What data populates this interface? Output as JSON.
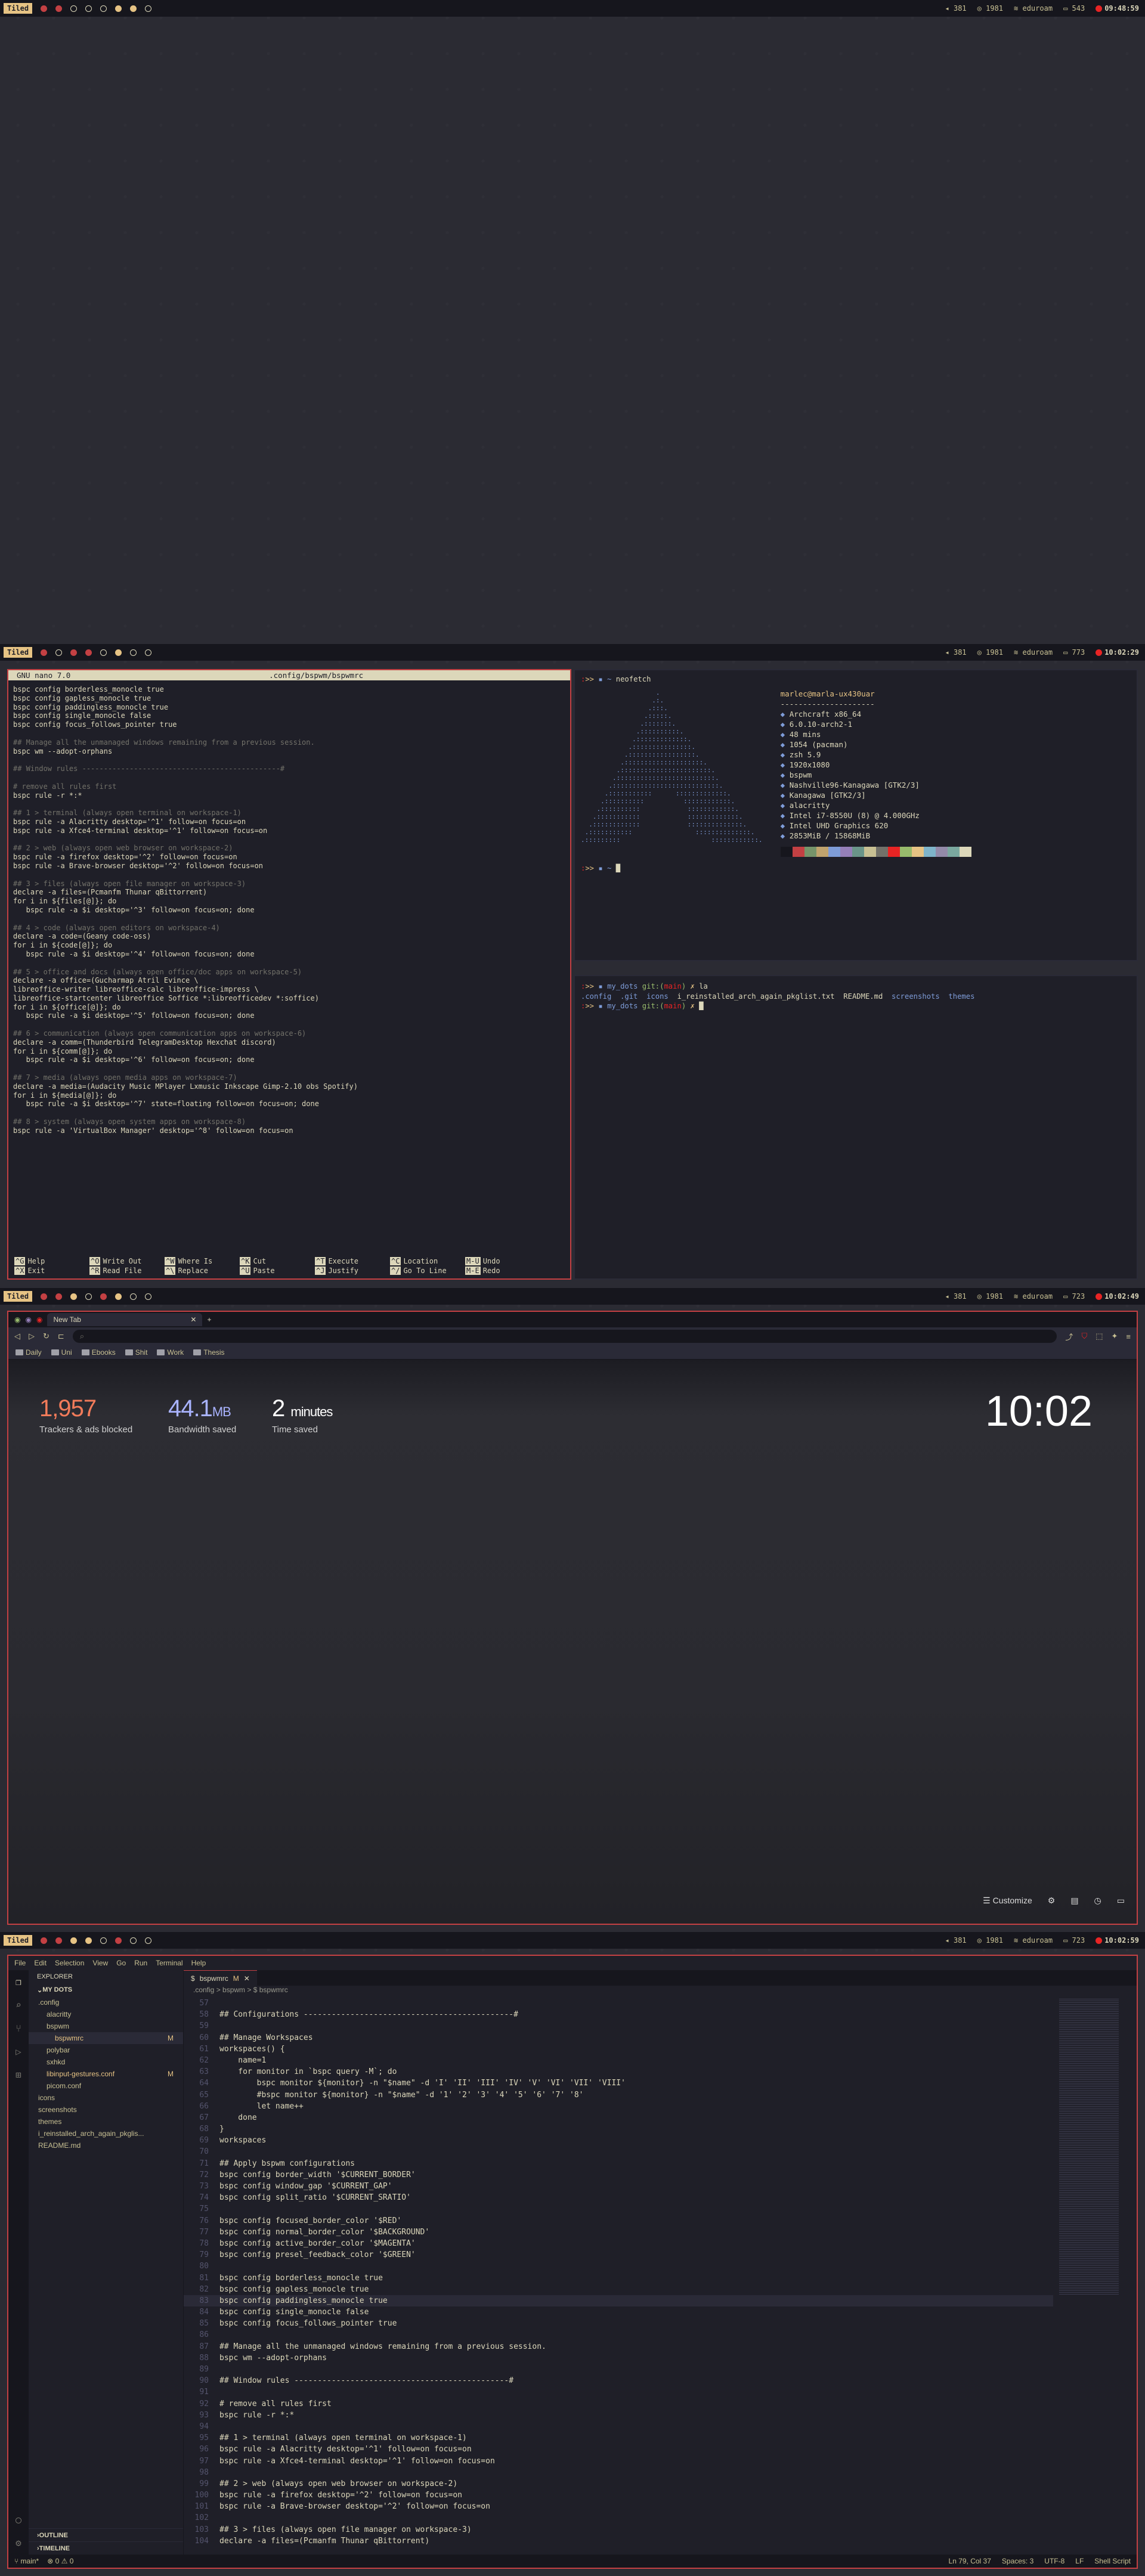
{
  "screens": [
    {
      "layout": "Tiled",
      "bar": {
        "vol": "381",
        "disk": "1981",
        "net": "eduroam",
        "bat": "543",
        "time": "09:48:59"
      }
    },
    {
      "layout": "Tiled",
      "bar": {
        "vol": "381",
        "disk": "1981",
        "net": "eduroam",
        "bat": "773",
        "time": "10:02:29"
      }
    },
    {
      "layout": "Tiled",
      "bar": {
        "vol": "381",
        "disk": "1981",
        "net": "eduroam",
        "bat": "723",
        "time": "10:02:49"
      }
    },
    {
      "layout": "Tiled",
      "bar": {
        "vol": "381",
        "disk": "1981",
        "net": "eduroam",
        "bat": "723",
        "time": "10:02:59"
      }
    }
  ],
  "nano": {
    "version": "GNU nano 7.0",
    "file": ".config/bspwm/bspwmrc",
    "lines": [
      "bspc config borderless_monocle true",
      "bspc config gapless_monocle true",
      "bspc config paddingless_monocle true",
      "bspc config single_monocle false",
      "bspc config focus_follows_pointer true",
      "",
      "## Manage all the unmanaged windows remaining from a previous session.",
      "bspc wm --adopt-orphans",
      "",
      "## Window rules ----------------------------------------------#",
      "",
      "# remove all rules first",
      "bspc rule -r *:*",
      "",
      "## 1 > terminal (always open terminal on workspace-1)",
      "bspc rule -a Alacritty desktop='^1' follow=on focus=on",
      "bspc rule -a Xfce4-terminal desktop='^1' follow=on focus=on",
      "",
      "## 2 > web (always open web browser on workspace-2)",
      "bspc rule -a firefox desktop='^2' follow=on focus=on",
      "bspc rule -a Brave-browser desktop='^2' follow=on focus=on",
      "",
      "## 3 > files (always open file manager on workspace-3)",
      "declare -a files=(Pcmanfm Thunar qBittorrent)",
      "for i in ${files[@]}; do",
      "   bspc rule -a $i desktop='^3' follow=on focus=on; done",
      "",
      "## 4 > code (always open editors on workspace-4)",
      "declare -a code=(Geany code-oss)",
      "for i in ${code[@]}; do",
      "   bspc rule -a $i desktop='^4' follow=on focus=on; done",
      "",
      "## 5 > office and docs (always open office/doc apps on workspace-5)",
      "declare -a office=(Gucharmap Atril Evince \\",
      "libreoffice-writer libreoffice-calc libreoffice-impress \\",
      "libreoffice-startcenter libreoffice Soffice *:libreofficedev *:soffice)",
      "for i in ${office[@]}; do",
      "   bspc rule -a $i desktop='^5' follow=on focus=on; done",
      "",
      "## 6 > communication (always open communication apps on workspace-6)",
      "declare -a comm=(Thunderbird TelegramDesktop Hexchat discord)",
      "for i in ${comm[@]}; do",
      "   bspc rule -a $i desktop='^6' follow=on focus=on; done",
      "",
      "## 7 > media (always open media apps on workspace-7)",
      "declare -a media=(Audacity Music MPlayer Lxmusic Inkscape Gimp-2.10 obs Spotify)",
      "for i in ${media[@]}; do",
      "   bspc rule -a $i desktop='^7' state=floating follow=on focus=on; done",
      "",
      "## 8 > system (always open system apps on workspace-8)",
      "bspc rule -a 'VirtualBox Manager' desktop='^8' follow=on focus=on"
    ],
    "help": [
      [
        "^G",
        "Help"
      ],
      [
        "^O",
        "Write Out"
      ],
      [
        "^W",
        "Where Is"
      ],
      [
        "^K",
        "Cut"
      ],
      [
        "^T",
        "Execute"
      ],
      [
        "^C",
        "Location"
      ],
      [
        "M-U",
        "Undo"
      ],
      [
        "^X",
        "Exit"
      ],
      [
        "^R",
        "Read File"
      ],
      [
        "^\\",
        "Replace"
      ],
      [
        "^U",
        "Paste"
      ],
      [
        "^J",
        "Justify"
      ],
      [
        "^/",
        "Go To Line"
      ],
      [
        "M-E",
        "Redo"
      ]
    ]
  },
  "neofetch": {
    "cmd": "neofetch",
    "userhost": "marlec@marla-ux430uar",
    "sep": "---------------------",
    "info": [
      " Archcraft x86_64",
      " 6.0.10-arch2-1",
      " 48 mins",
      " 1054 (pacman)",
      " zsh 5.9",
      " 1920x1080",
      " bspwm",
      " Nashville96-Kanagawa [GTK2/3]",
      " Kanagawa [GTK2/3]",
      " alacritty",
      " Intel i7-8550U (8) @ 4.000GHz",
      " Intel UHD Graphics 620",
      " 2853MiB / 15868MiB"
    ],
    "colors": [
      "#16161d",
      "#c34043",
      "#76946a",
      "#c0a36e",
      "#7e9cd8",
      "#957fb8",
      "#6a9589",
      "#c8c093",
      "#727169",
      "#e82424",
      "#98bb6c",
      "#e6c384",
      "#7fb4ca",
      "#938aa9",
      "#7aa89f",
      "#dcd7ba"
    ]
  },
  "term2": {
    "dir": "my_dots",
    "branch": "main",
    "cmd": "la",
    "files": [
      ".config",
      ".git",
      "icons",
      "i_reinstalled_arch_again_pkglist.txt",
      "README.md",
      "screenshots",
      "themes"
    ]
  },
  "brave": {
    "tab": "New Tab",
    "bookmarks": [
      "Daily",
      "Uni",
      "Ebooks",
      "Shit",
      "Work",
      "Thesis"
    ],
    "trackers": "1,957",
    "trackers_label": "Trackers & ads blocked",
    "bandwidth": "44.1",
    "bandwidth_unit": "MB",
    "bandwidth_label": "Bandwidth saved",
    "timesaved": "2",
    "timesaved_unit": "minutes",
    "timesaved_label": "Time saved",
    "clock": "10:02",
    "customize": "Customize"
  },
  "vscode": {
    "menu": [
      "File",
      "Edit",
      "Selection",
      "View",
      "Go",
      "Run",
      "Terminal",
      "Help"
    ],
    "explorer": "EXPLORER",
    "project": "MY DOTS",
    "tree": [
      {
        "name": ".config",
        "m": ""
      },
      {
        "name": "alacritty",
        "m": ""
      },
      {
        "name": "bspwm",
        "m": ""
      },
      {
        "name": "bspwmrc",
        "m": "M"
      },
      {
        "name": "polybar",
        "m": ""
      },
      {
        "name": "sxhkd",
        "m": ""
      },
      {
        "name": "libinput-gestures.conf",
        "m": "M"
      },
      {
        "name": "picom.conf",
        "m": ""
      },
      {
        "name": "icons",
        "m": ""
      },
      {
        "name": "screenshots",
        "m": ""
      },
      {
        "name": "themes",
        "m": ""
      },
      {
        "name": "i_reinstalled_arch_again_pkglis...",
        "m": ""
      },
      {
        "name": "README.md",
        "m": ""
      }
    ],
    "outline": "OUTLINE",
    "timeline": "TIMELINE",
    "tab": "bspwmrc",
    "crumb": ".config > bspwm > $ bspwmrc",
    "code": [
      [
        "57",
        ""
      ],
      [
        "58",
        "## Configurations ---------------------------------------------#"
      ],
      [
        "59",
        ""
      ],
      [
        "60",
        "## Manage Workspaces"
      ],
      [
        "61",
        "workspaces() {"
      ],
      [
        "62",
        "    name=1"
      ],
      [
        "63",
        "    for monitor in `bspc query -M`; do"
      ],
      [
        "64",
        "        bspc monitor ${monitor} -n \"$name\" -d 'I' 'II' 'III' 'IV' 'V' 'VI' 'VII' 'VIII'"
      ],
      [
        "65",
        "        #bspc monitor ${monitor} -n \"$name\" -d '1' '2' '3' '4' '5' '6' '7' '8'"
      ],
      [
        "66",
        "        let name++"
      ],
      [
        "67",
        "    done"
      ],
      [
        "68",
        "}"
      ],
      [
        "69",
        "workspaces"
      ],
      [
        "70",
        ""
      ],
      [
        "71",
        "## Apply bspwm configurations"
      ],
      [
        "72",
        "bspc config border_width '$CURRENT_BORDER'"
      ],
      [
        "73",
        "bspc config window_gap '$CURRENT_GAP'"
      ],
      [
        "74",
        "bspc config split_ratio '$CURRENT_SRATIO'"
      ],
      [
        "75",
        ""
      ],
      [
        "76",
        "bspc config focused_border_color '$RED'"
      ],
      [
        "77",
        "bspc config normal_border_color '$BACKGROUND'"
      ],
      [
        "78",
        "bspc config active_border_color '$MAGENTA'"
      ],
      [
        "79",
        "bspc config presel_feedback_color '$GREEN'"
      ],
      [
        "80",
        ""
      ],
      [
        "81",
        "bspc config borderless_monocle true"
      ],
      [
        "82",
        "bspc config gapless_monocle true"
      ],
      [
        "83",
        "bspc config paddingless_monocle true"
      ],
      [
        "84",
        "bspc config single_monocle false"
      ],
      [
        "85",
        "bspc config focus_follows_pointer true"
      ],
      [
        "86",
        ""
      ],
      [
        "87",
        "## Manage all the unmanaged windows remaining from a previous session."
      ],
      [
        "88",
        "bspc wm --adopt-orphans"
      ],
      [
        "89",
        ""
      ],
      [
        "90",
        "## Window rules ----------------------------------------------#"
      ],
      [
        "91",
        ""
      ],
      [
        "92",
        "# remove all rules first"
      ],
      [
        "93",
        "bspc rule -r *:*"
      ],
      [
        "94",
        ""
      ],
      [
        "95",
        "## 1 > terminal (always open terminal on workspace-1)"
      ],
      [
        "96",
        "bspc rule -a Alacritty desktop='^1' follow=on focus=on"
      ],
      [
        "97",
        "bspc rule -a Xfce4-terminal desktop='^1' follow=on focus=on"
      ],
      [
        "98",
        ""
      ],
      [
        "99",
        "## 2 > web (always open web browser on workspace-2)"
      ],
      [
        "100",
        "bspc rule -a firefox desktop='^2' follow=on focus=on"
      ],
      [
        "101",
        "bspc rule -a Brave-browser desktop='^2' follow=on focus=on"
      ],
      [
        "102",
        ""
      ],
      [
        "103",
        "## 3 > files (always open file manager on workspace-3)"
      ],
      [
        "104",
        "declare -a files=(Pcmanfm Thunar qBittorrent)"
      ]
    ],
    "status_left": [
      "main*",
      "⊗ 0 ⚠ 0"
    ],
    "status_right": [
      "Ln 79, Col 37",
      "Spaces: 3",
      "UTF-8",
      "LF",
      "Shell Script"
    ]
  }
}
